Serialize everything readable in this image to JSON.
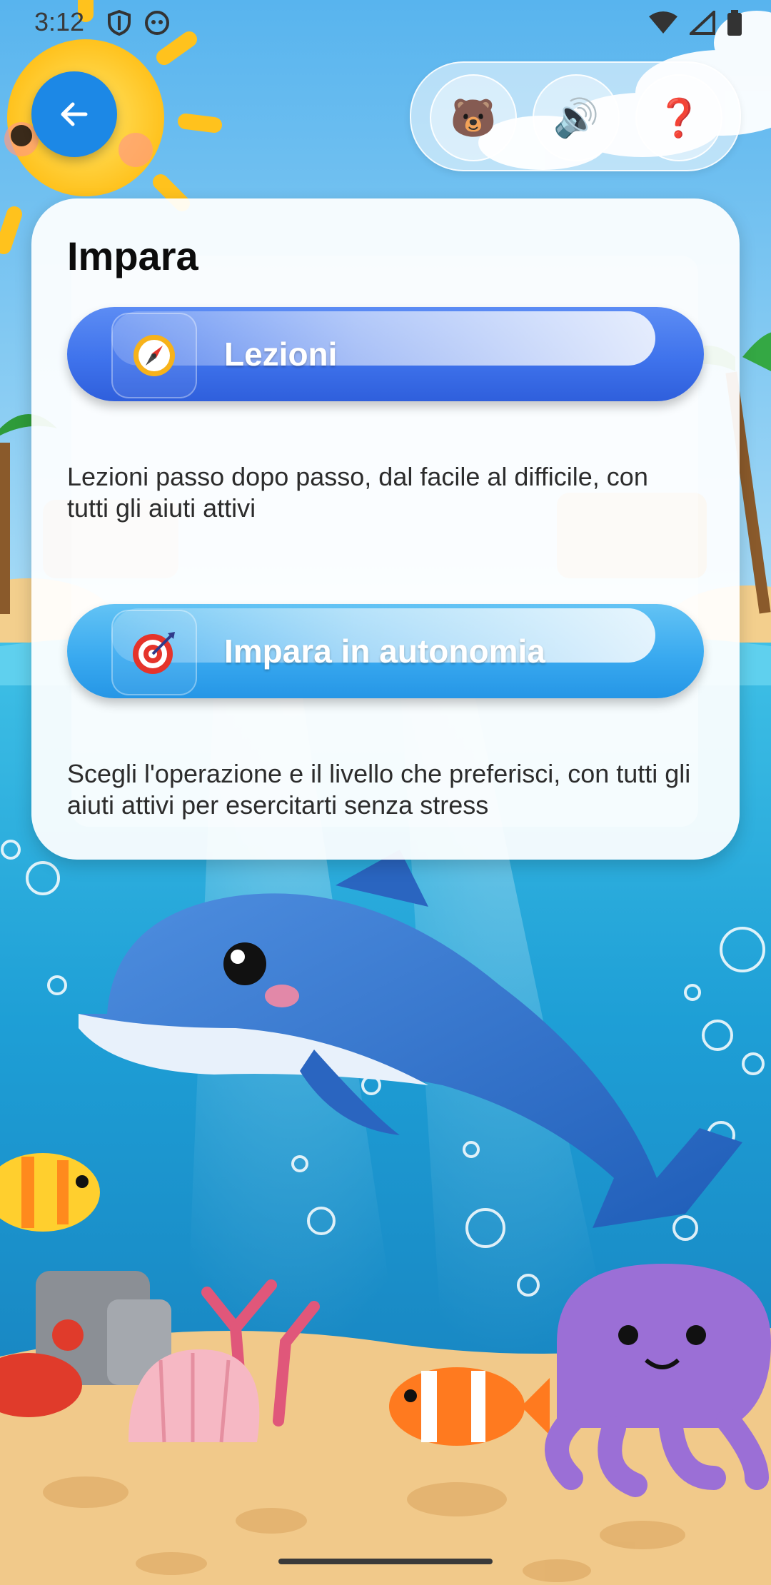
{
  "status_bar": {
    "time": "3:12"
  },
  "toolbar": {
    "back_icon": "arrow-left-icon",
    "mascot_emoji": "🐻",
    "sound_emoji": "🔊",
    "help_emoji": "❓"
  },
  "card": {
    "title": "Impara",
    "options": [
      {
        "label": "Lezioni",
        "icon": "compass-icon",
        "description": "Lezioni passo dopo passo, dal facile al difficile, con tutti gli aiuti attivi",
        "color": "#3f73ec"
      },
      {
        "label": "Impara in autonomia",
        "icon": "target-icon",
        "description": "Scegli l'operazione e il livello che preferisci, con tutti gli aiuti attivi per esercitarti senza stress",
        "color": "#2ea4ee"
      }
    ]
  },
  "colors": {
    "accent": "#1c88e6",
    "sky": "#7cc6f2",
    "sea": "#1aa0d8",
    "sand": "#f1c98a"
  }
}
